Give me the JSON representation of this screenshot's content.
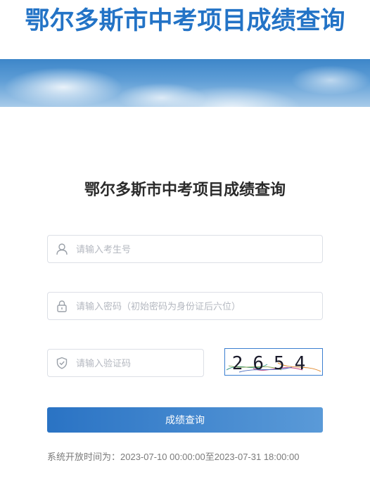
{
  "page": {
    "header_title": "鄂尔多斯市中考项目成绩查询",
    "form_title": "鄂尔多斯市中考项目成绩查询"
  },
  "form": {
    "username_placeholder": "请输入考生号",
    "password_placeholder": "请输入密码（初始密码为身份证后六位）",
    "captcha_placeholder": "请输入验证码",
    "captcha_text": "2654",
    "submit_label": "成绩查询"
  },
  "footer": {
    "open_time": "系统开放时间为：2023-07-10 00:00:00至2023-07-31 18:00:00"
  },
  "icons": {
    "username": "user-icon",
    "password": "lock-icon",
    "captcha": "shield-icon"
  },
  "colors": {
    "title": "#2373c6",
    "button_start": "#2a73c4",
    "button_end": "#5a9ad8",
    "captcha_border": "#3b7fd0"
  }
}
